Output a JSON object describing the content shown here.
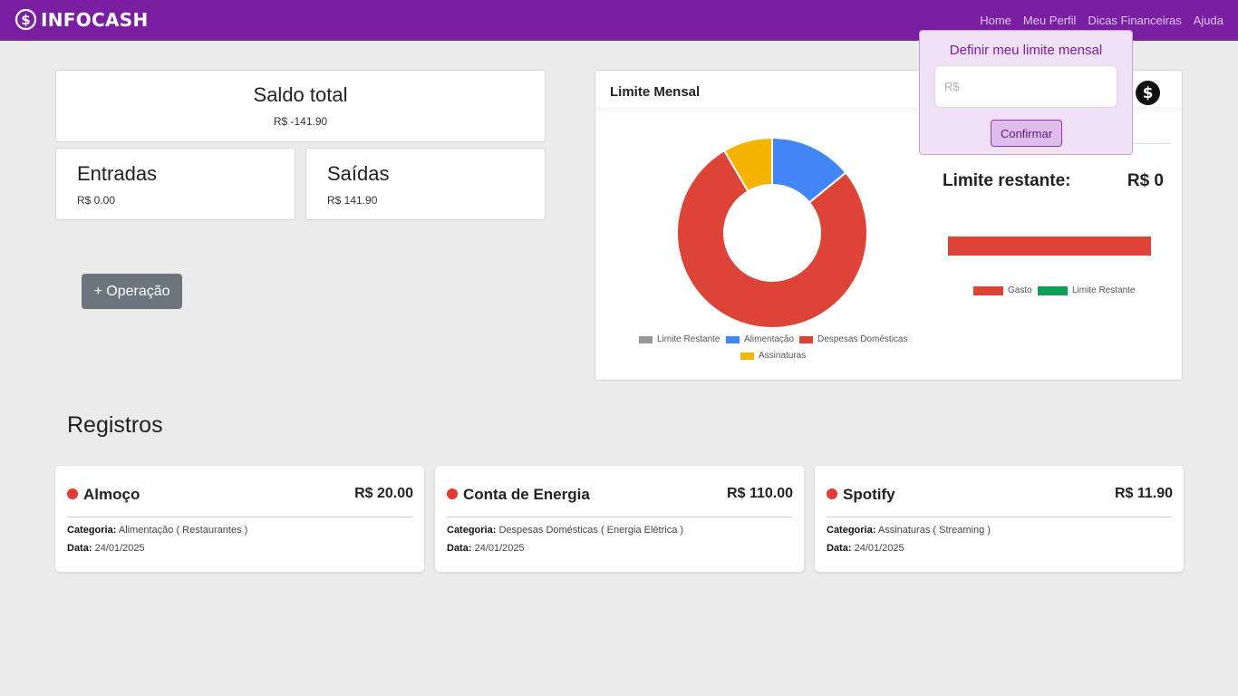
{
  "app": {
    "brand": "INFOCASH",
    "nav": [
      "Home",
      "Meu Perfil",
      "Dicas Financeiras",
      "Ajuda"
    ]
  },
  "summary": {
    "saldo_title": "Saldo total",
    "saldo_value": "R$ -141.90",
    "entradas_title": "Entradas",
    "entradas_value": "R$ 0.00",
    "saidas_title": "Saídas",
    "saidas_value": "R$ 141.90"
  },
  "operacao_button": "+ Operação",
  "limite": {
    "header": "Limite Mensal",
    "restante_label": "Limite restante:",
    "restante_value": "R$ 0",
    "bar_legend": [
      {
        "label": "Gasto",
        "color": "#db4437"
      },
      {
        "label": "Limite Restante",
        "color": "#0f9d58"
      }
    ]
  },
  "chart_data": {
    "type": "pie",
    "donut": true,
    "categories": [
      "Limite Restante",
      "Alimentação",
      "Despesas Domésticas",
      "Assinaturas"
    ],
    "values": [
      0,
      20.0,
      110.0,
      11.9
    ],
    "colors": [
      "#999999",
      "#4285f4",
      "#db4437",
      "#f4b400"
    ],
    "legend": "bottom"
  },
  "popup": {
    "title": "Definir meu limite mensal",
    "input_placeholder": "R$",
    "confirm_label": "Confirmar"
  },
  "registros": {
    "title": "Registros",
    "category_label": "Categoria:",
    "date_label": "Data:",
    "items": [
      {
        "name": "Almoço",
        "amount": "R$ 20.00",
        "category": "Alimentação ( Restaurantes )",
        "date": "24/01/2025"
      },
      {
        "name": "Conta de Energia",
        "amount": "R$ 110.00",
        "category": "Despesas Domésticas ( Energia Elétrica )",
        "date": "24/01/2025"
      },
      {
        "name": "Spotify",
        "amount": "R$ 11.90",
        "category": "Assinaturas ( Streaming )",
        "date": "24/01/2025"
      }
    ]
  }
}
